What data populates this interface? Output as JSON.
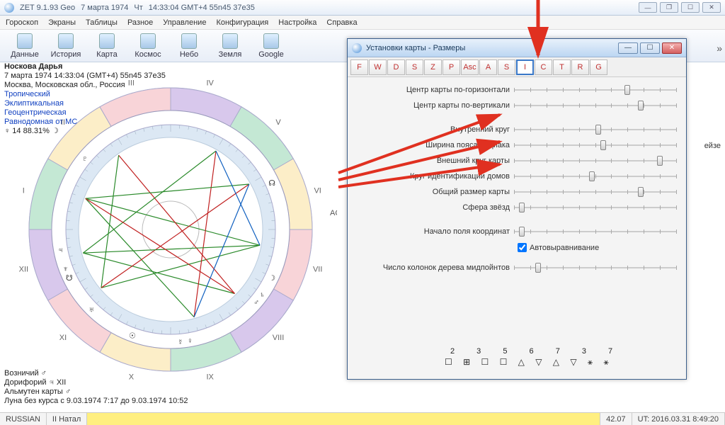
{
  "title": {
    "app": "ZET 9.1.93 Geo",
    "date": "7 марта 1974",
    "dow": "Чт",
    "time": "14:33:04 GMT+4 55n45  37e35"
  },
  "menu": [
    "Гороскоп",
    "Экраны",
    "Таблицы",
    "Разное",
    "Управление",
    "Конфигурация",
    "Настройка",
    "Справка"
  ],
  "toolbar": [
    {
      "label": "Данные"
    },
    {
      "label": "История"
    },
    {
      "label": "Карта"
    },
    {
      "label": "Космос"
    },
    {
      "label": "Небо"
    },
    {
      "label": "Земля"
    },
    {
      "label": "Google"
    }
  ],
  "chart_header": {
    "name": "Носкова Дарья",
    "line2": "7 марта 1974  14:33:04  (GMT+4)  55n45   37e35",
    "line3": "Москва, Московская обл., Россия",
    "sys1": "Тропический",
    "sys2": "Эклиптикальная",
    "sys3": "Геоцентрическая",
    "sys4": "Равнодомная от MC",
    "extra": "♀  14 88.31% ☽"
  },
  "houses": [
    "I",
    "II",
    "III",
    "IV",
    "V",
    "VI",
    "VII",
    "VIII",
    "IX",
    "X",
    "XI",
    "XII"
  ],
  "bottom": {
    "l1": "Возничий  ♂",
    "l2": "Дорифорий ♃   XII",
    "l3": "Альмутен карты ♂",
    "l4": "Луна без курса с 9.03.1974  7:17 до 9.03.1974  10:52"
  },
  "dialog": {
    "title": "Установки карты - Размеры",
    "tabs": [
      "F",
      "W",
      "D",
      "S",
      "Z",
      "P",
      "Asc",
      "A",
      "S",
      "I",
      "C",
      "T",
      "R",
      "G"
    ],
    "sliders": [
      {
        "label": "Центр карты по-горизонтали",
        "pos": 70
      },
      {
        "label": "Центр карты по-вертикали",
        "pos": 78
      },
      {
        "label": "Внутренний круг",
        "pos": 52
      },
      {
        "label": "Ширина пояса Зодиака",
        "pos": 55
      },
      {
        "label": "Внешний круг карты",
        "pos": 90
      },
      {
        "label": "Круг идентификации домов",
        "pos": 48
      },
      {
        "label": "Общий размер карты",
        "pos": 78
      },
      {
        "label": "Сфера звёзд",
        "pos": 5
      }
    ],
    "slider_coord": {
      "label": "Начало поля координат",
      "pos": 5
    },
    "checkbox": "Автовыравнивание",
    "slider_cols": {
      "label": "Число колонок дерева мидпойнтов",
      "pos": 15
    },
    "nums": "2  3  5      6  7    3  7",
    "syms": "☐ ⊞ ☐ ☐    △ ▽ △ ▽    ⚹ ⚹"
  },
  "side": "ейзе",
  "status": {
    "lang": "RUSSIAN",
    "mode": "II Натал",
    "val": "42.07",
    "ut": "UT: 2016.03.31  8:49:20"
  }
}
